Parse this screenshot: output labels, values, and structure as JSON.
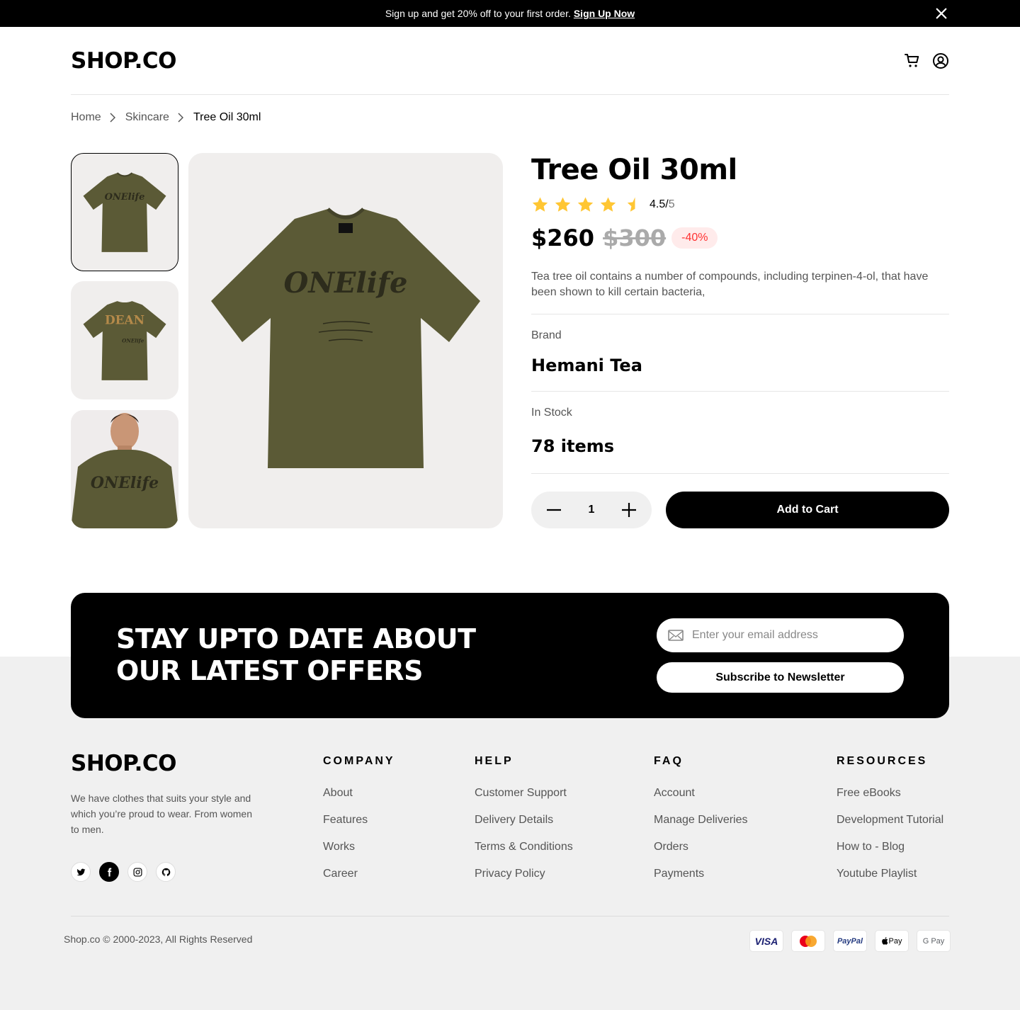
{
  "banner": {
    "text": "Sign up and get 20% off to your first order.",
    "link": "Sign Up Now"
  },
  "header": {
    "logo": "SHOP.CO"
  },
  "breadcrumb": {
    "items": [
      "Home",
      "Skincare"
    ],
    "current": "Tree Oil 30ml"
  },
  "product": {
    "title": "Tree Oil 30ml",
    "rating": 4.5,
    "rating_value": "4.5/",
    "rating_out": "5",
    "price": "$260",
    "old_price": "$300",
    "discount": "-40%",
    "description": "Tea tree oil contains a number of compounds, including terpinen-4-ol, that have been shown to kill certain bacteria,",
    "brand_label": "Brand",
    "brand": "Hemani Tea",
    "stock_label": "In Stock",
    "stock": "78 items",
    "quantity": "1",
    "add_to_cart": "Add to Cart",
    "shirt_print": "ONElife",
    "shirt_print_back": "DEAN"
  },
  "newsletter": {
    "title_line1": "STAY UPTO DATE ABOUT",
    "title_line2": "OUR LATEST OFFERS",
    "placeholder": "Enter your email address",
    "button": "Subscribe to Newsletter"
  },
  "footer": {
    "logo": "SHOP.CO",
    "about": "We have clothes that suits your style and which you’re proud to wear. From women to men.",
    "columns": [
      {
        "title": "COMPANY",
        "links": [
          "About",
          "Features",
          "Works",
          "Career"
        ]
      },
      {
        "title": "HELP",
        "links": [
          "Customer Support",
          "Delivery Details",
          "Terms & Conditions",
          "Privacy Policy"
        ]
      },
      {
        "title": "FAQ",
        "links": [
          "Account",
          "Manage Deliveries",
          "Orders",
          "Payments"
        ]
      },
      {
        "title": "RESOURCES",
        "links": [
          "Free eBooks",
          "Development Tutorial",
          "How to - Blog",
          "Youtube Playlist"
        ]
      }
    ],
    "copyright": "Shop.co © 2000-2023, All Rights Reserved",
    "payments": {
      "visa": "VISA",
      "paypal": "PayPal",
      "applepay": "Pay",
      "googlepay": "G Pay"
    }
  },
  "colors": {
    "star": "#FFC633",
    "shirt": "#5b5a36",
    "discount_text": "#FF3333",
    "discount_bg": "#FFEBEB"
  }
}
